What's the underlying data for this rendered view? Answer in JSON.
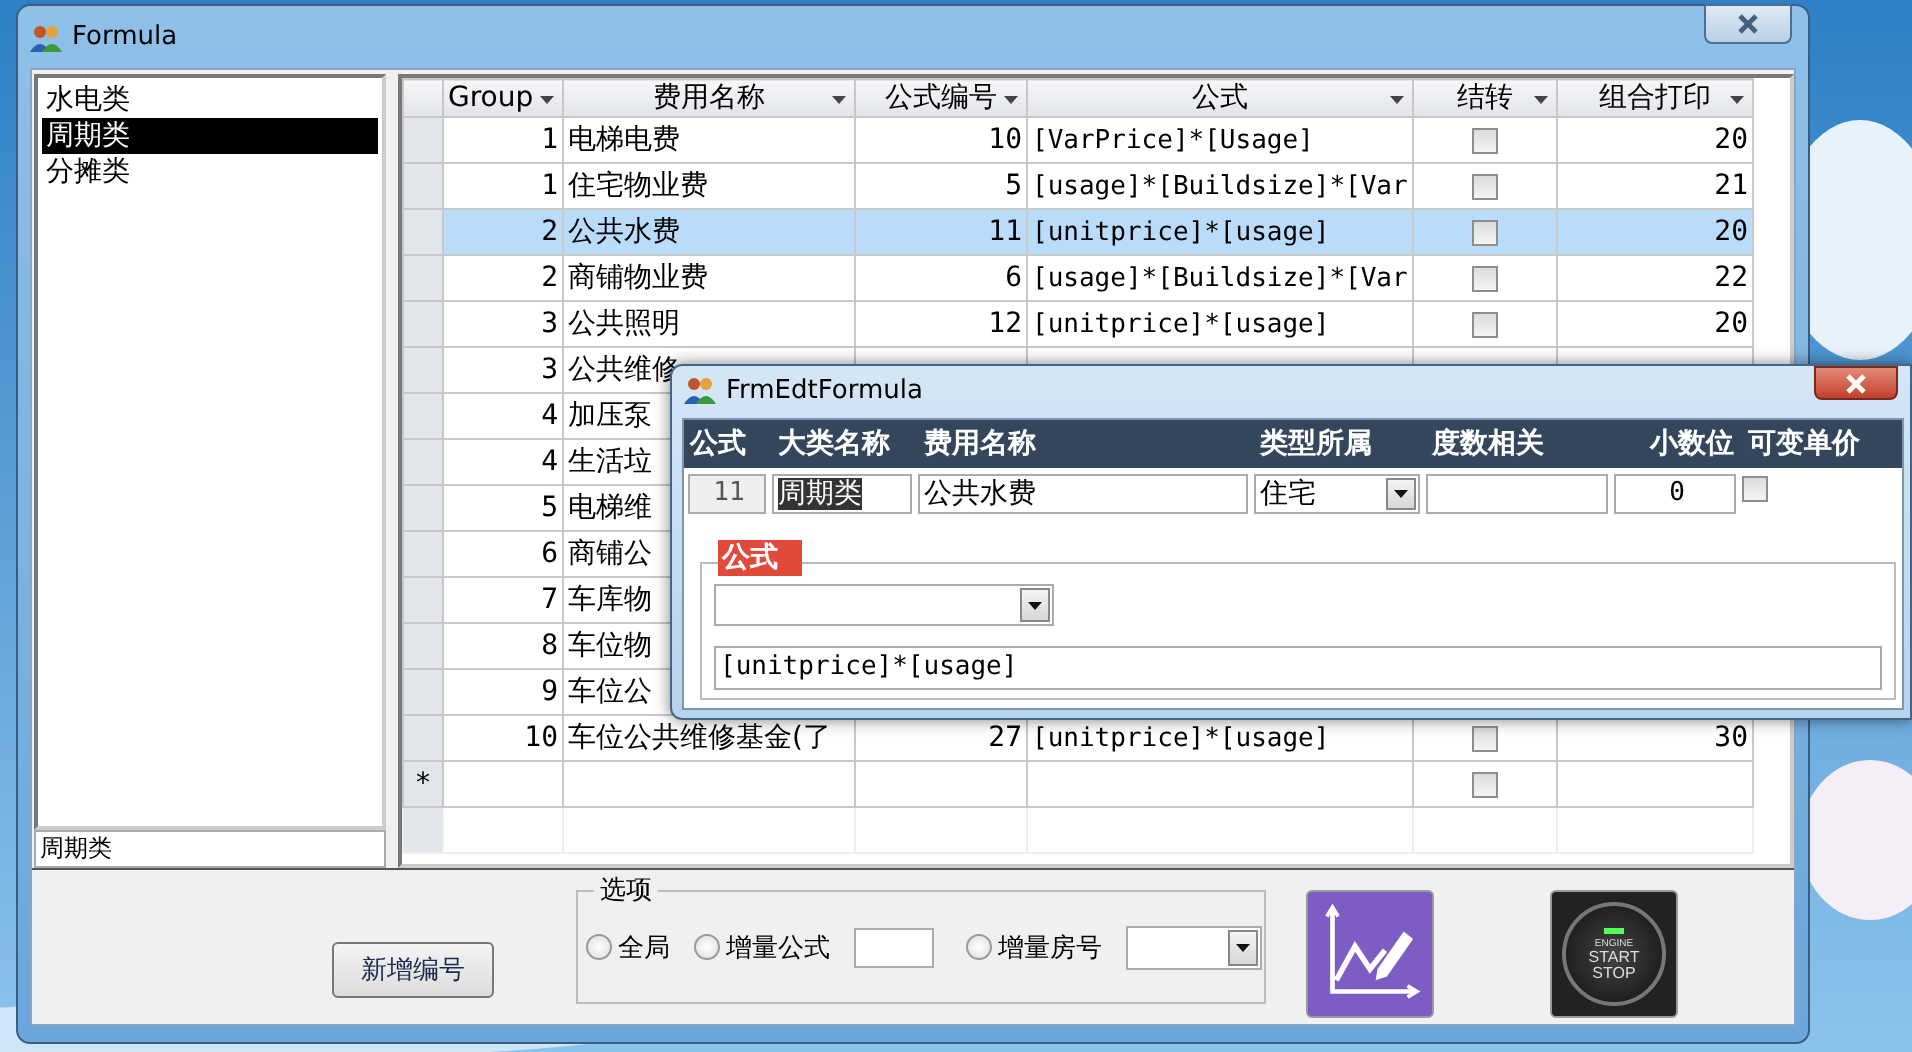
{
  "window": {
    "title": "Formula"
  },
  "category_list": {
    "items": [
      {
        "label": "水电类",
        "selected": false
      },
      {
        "label": "周期类",
        "selected": true
      },
      {
        "label": "分摊类",
        "selected": false
      }
    ],
    "current": "周期类"
  },
  "grid": {
    "columns": [
      "Group",
      "费用名称",
      "公式编号",
      "公式",
      "结转",
      "组合打印"
    ],
    "rows": [
      {
        "group": "1",
        "name": "电梯电费",
        "code": "10",
        "formula": "[VarPrice]*[Usage]",
        "carry": false,
        "print": "20",
        "selected": false
      },
      {
        "group": "1",
        "name": "住宅物业费",
        "code": "5",
        "formula": "[usage]*[Buildsize]*[Var",
        "carry": false,
        "print": "21",
        "selected": false
      },
      {
        "group": "2",
        "name": "公共水费",
        "code": "11",
        "formula": "[unitprice]*[usage]",
        "carry": false,
        "print": "20",
        "selected": true
      },
      {
        "group": "2",
        "name": "商铺物业费",
        "code": "6",
        "formula": "[usage]*[Buildsize]*[Var",
        "carry": false,
        "print": "22",
        "selected": false
      },
      {
        "group": "3",
        "name": "公共照明",
        "code": "12",
        "formula": "[unitprice]*[usage]",
        "carry": false,
        "print": "20",
        "selected": false
      },
      {
        "group": "3",
        "name": "公共维修",
        "selected": false
      },
      {
        "group": "4",
        "name": "加压泵",
        "selected": false
      },
      {
        "group": "4",
        "name": "生活垃",
        "selected": false
      },
      {
        "group": "5",
        "name": "电梯维",
        "selected": false
      },
      {
        "group": "6",
        "name": "商铺公",
        "selected": false
      },
      {
        "group": "7",
        "name": "车库物",
        "selected": false
      },
      {
        "group": "8",
        "name": "车位物",
        "selected": false
      },
      {
        "group": "9",
        "name": "车位公",
        "selected": false
      },
      {
        "group": "10",
        "name": "车位公共维修基金(了",
        "code": "27",
        "formula": "[unitprice]*[usage]",
        "carry": false,
        "print": "30",
        "selected": false
      }
    ],
    "new_row": {
      "marker": "*",
      "carry": false
    }
  },
  "add_button": "新增编号",
  "options": {
    "title": "选项",
    "items": [
      {
        "kind": "radio",
        "label": "全局",
        "selected": false
      },
      {
        "kind": "radio-field",
        "label": "增量公式",
        "selected": false
      },
      {
        "kind": "radio-combo",
        "label": "增量房号",
        "selected": false
      }
    ]
  },
  "start_button": {
    "labels": [
      "ENGINE",
      "START",
      "STOP"
    ]
  },
  "dialog": {
    "title": "FrmEdtFormula",
    "headers": [
      "公式",
      "大类名称",
      "费用名称",
      "类型所属",
      "度数相关",
      "小数位",
      "可变单价"
    ],
    "code": "11",
    "category": "周期类",
    "name": "公共水费",
    "type": "住宅",
    "decimals": "0",
    "variable_price": false,
    "group_title": "公式",
    "formula": "[unitprice]*[usage]"
  }
}
